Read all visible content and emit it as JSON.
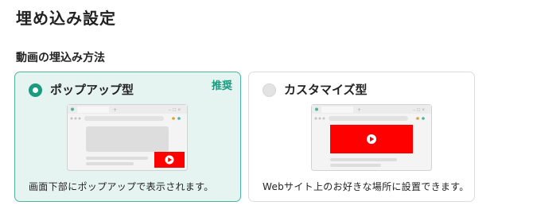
{
  "page": {
    "title": "埋め込み設定"
  },
  "section": {
    "label": "動画の埋込み方法"
  },
  "options": [
    {
      "title": "ポップアップ型",
      "badge": "推奨",
      "description": "画面下部にポップアップで表示されます。",
      "selected": true
    },
    {
      "title": "カスタマイズ型",
      "description": "Webサイト上のお好きな場所に設置できます。",
      "selected": false
    }
  ],
  "colors": {
    "accent": "#1a9a7e",
    "selected_card_bg": "#e6f4f1",
    "video_red": "#ff0000"
  }
}
